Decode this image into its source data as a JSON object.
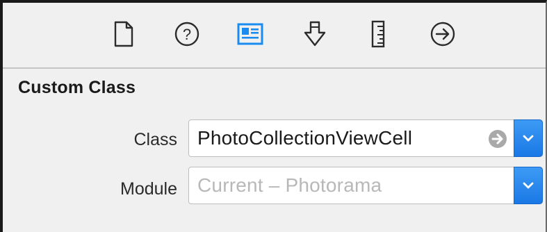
{
  "toolbar": {
    "tabs": [
      {
        "icon": "file-icon",
        "selected": false
      },
      {
        "icon": "help-icon",
        "selected": false
      },
      {
        "icon": "identity-icon",
        "selected": true
      },
      {
        "icon": "attributes-icon",
        "selected": false
      },
      {
        "icon": "ruler-icon",
        "selected": false
      },
      {
        "icon": "connections-icon",
        "selected": false
      }
    ],
    "accent_color": "#1a8cf0"
  },
  "custom_class": {
    "title": "Custom Class",
    "class_label": "Class",
    "class_value": "PhotoCollectionViewCell",
    "module_label": "Module",
    "module_placeholder": "Current – Photorama"
  }
}
